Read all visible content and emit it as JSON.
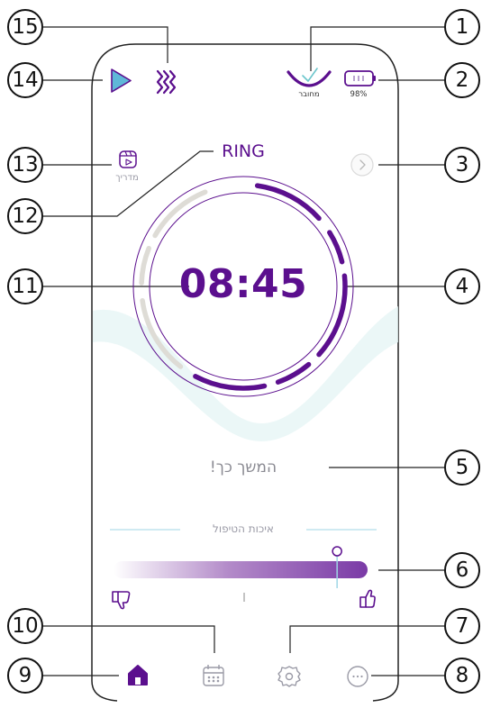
{
  "status": {
    "connection_label": "מחובר",
    "battery_percent": "98%"
  },
  "guide": {
    "label": "מדריך"
  },
  "ring": {
    "label": "RING"
  },
  "timer": {
    "value": "08:45"
  },
  "message": {
    "encouragement": "המשך כך!"
  },
  "treatment_quality": {
    "title": "איכות הטיפול",
    "level": 0.88
  },
  "nav": {
    "items": [
      "home",
      "calendar",
      "settings",
      "more"
    ],
    "active": "home"
  },
  "colors": {
    "brand": "#5b0f8e",
    "play": "#5fb8d8",
    "arc_light": "#dedcd6",
    "wave": "#e6f5f5"
  },
  "callouts": [
    "1",
    "2",
    "3",
    "4",
    "5",
    "6",
    "7",
    "8",
    "9",
    "10",
    "11",
    "12",
    "13",
    "14",
    "15"
  ]
}
